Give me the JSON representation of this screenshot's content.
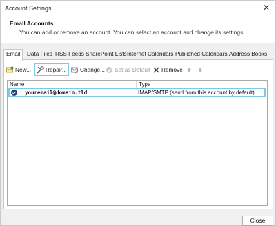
{
  "window": {
    "title": "Account Settings"
  },
  "header": {
    "title": "Email Accounts",
    "description": "You can add or remove an account. You can select an account and change its settings."
  },
  "tabs": [
    {
      "label": "Email"
    },
    {
      "label": "Data Files"
    },
    {
      "label": "RSS Feeds"
    },
    {
      "label": "SharePoint Lists"
    },
    {
      "label": "Internet Calendars"
    },
    {
      "label": "Published Calendars"
    },
    {
      "label": "Address Books"
    }
  ],
  "toolbar": {
    "new_label": "New...",
    "repair_label": "Repair...",
    "change_label": "Change...",
    "set_default_label": "Set as Default",
    "remove_label": "Remove"
  },
  "accounts_list": {
    "columns": [
      "Name",
      "Type"
    ],
    "rows": [
      {
        "name": "youremail@domain.tld",
        "type": "IMAP/SMTP (send from this account by default)"
      }
    ]
  },
  "footer": {
    "close_label": "Close"
  },
  "colors": {
    "highlight": "#7ec8e8",
    "default_badge": "#1f3d73"
  }
}
